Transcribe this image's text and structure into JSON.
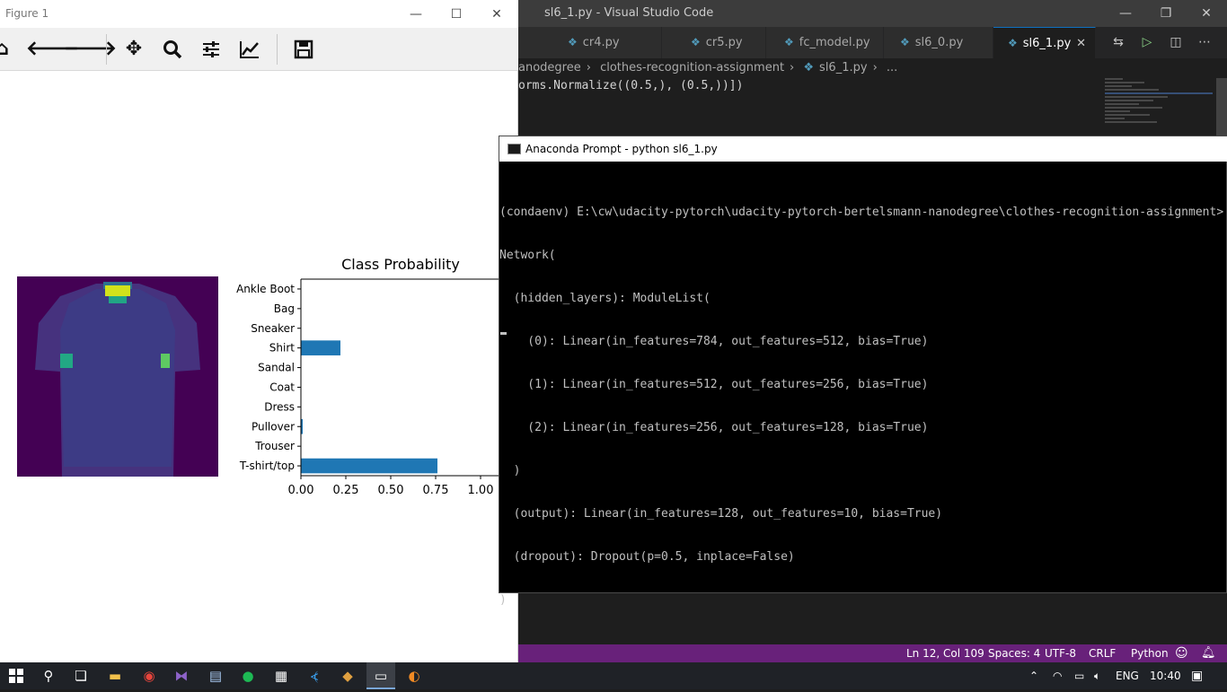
{
  "vscode": {
    "window_title": "sl6_1.py - Visual Studio Code",
    "tabs": [
      {
        "label": "cr4.py",
        "active": false
      },
      {
        "label": "cr5.py",
        "active": false
      },
      {
        "label": "fc_model.py",
        "active": false
      },
      {
        "label": "sl6_0.py",
        "active": false
      },
      {
        "label": "sl6_1.py",
        "active": true
      }
    ],
    "breadcrumb": [
      "anodegree",
      "clothes-recognition-assignment",
      "sl6_1.py",
      "..."
    ],
    "code_line": "orms.Normalize((0.5,), (0.5,))])",
    "status": {
      "position": "Ln 12, Col 109",
      "spaces": "Spaces: 4",
      "encoding": "UTF-8",
      "eol": "CRLF",
      "language": "Python"
    }
  },
  "figure": {
    "window_title": "Figure 1",
    "toolbar_icons": [
      "home-icon",
      "back-arrow-icon",
      "forward-arrow-icon",
      "pan-icon",
      "zoom-icon",
      "configure-subplots-icon",
      "edit-axis-icon",
      "save-icon"
    ]
  },
  "chart_data": {
    "type": "bar",
    "orientation": "horizontal",
    "title": "Class Probability",
    "categories": [
      "Ankle Boot",
      "Bag",
      "Sneaker",
      "Shirt",
      "Sandal",
      "Coat",
      "Dress",
      "Pullover",
      "Trouser",
      "T-shirt/top"
    ],
    "values": [
      0.0,
      0.0,
      0.0,
      0.22,
      0.0,
      0.0,
      0.0,
      0.01,
      0.0,
      0.76
    ],
    "xticks": [
      "0.00",
      "0.25",
      "0.50",
      "0.75",
      "1.00"
    ],
    "xlim": [
      0,
      1.1
    ],
    "bar_color": "#1f77b4",
    "grid": false
  },
  "conda": {
    "window_title": "Anaconda Prompt - python  sl6_1.py",
    "lines": [
      "(condaenv) E:\\cw\\udacity-pytorch\\udacity-pytorch-bertelsmann-nanodegree\\clothes-recognition-assignment>",
      "Network(",
      "  (hidden_layers): ModuleList(",
      "    (0): Linear(in_features=784, out_features=512, bias=True)",
      "    (1): Linear(in_features=512, out_features=256, bias=True)",
      "    (2): Linear(in_features=256, out_features=128, bias=True)",
      "  )",
      "  (output): Linear(in_features=128, out_features=10, bias=True)",
      "  (dropout): Dropout(p=0.5, inplace=False)",
      ")"
    ]
  },
  "taskbar": {
    "language": "ENG",
    "time": "10:40"
  },
  "colors": {
    "vscode_status": "#68217a",
    "bar": "#1f77b4",
    "viridis_dark": "#440154"
  }
}
